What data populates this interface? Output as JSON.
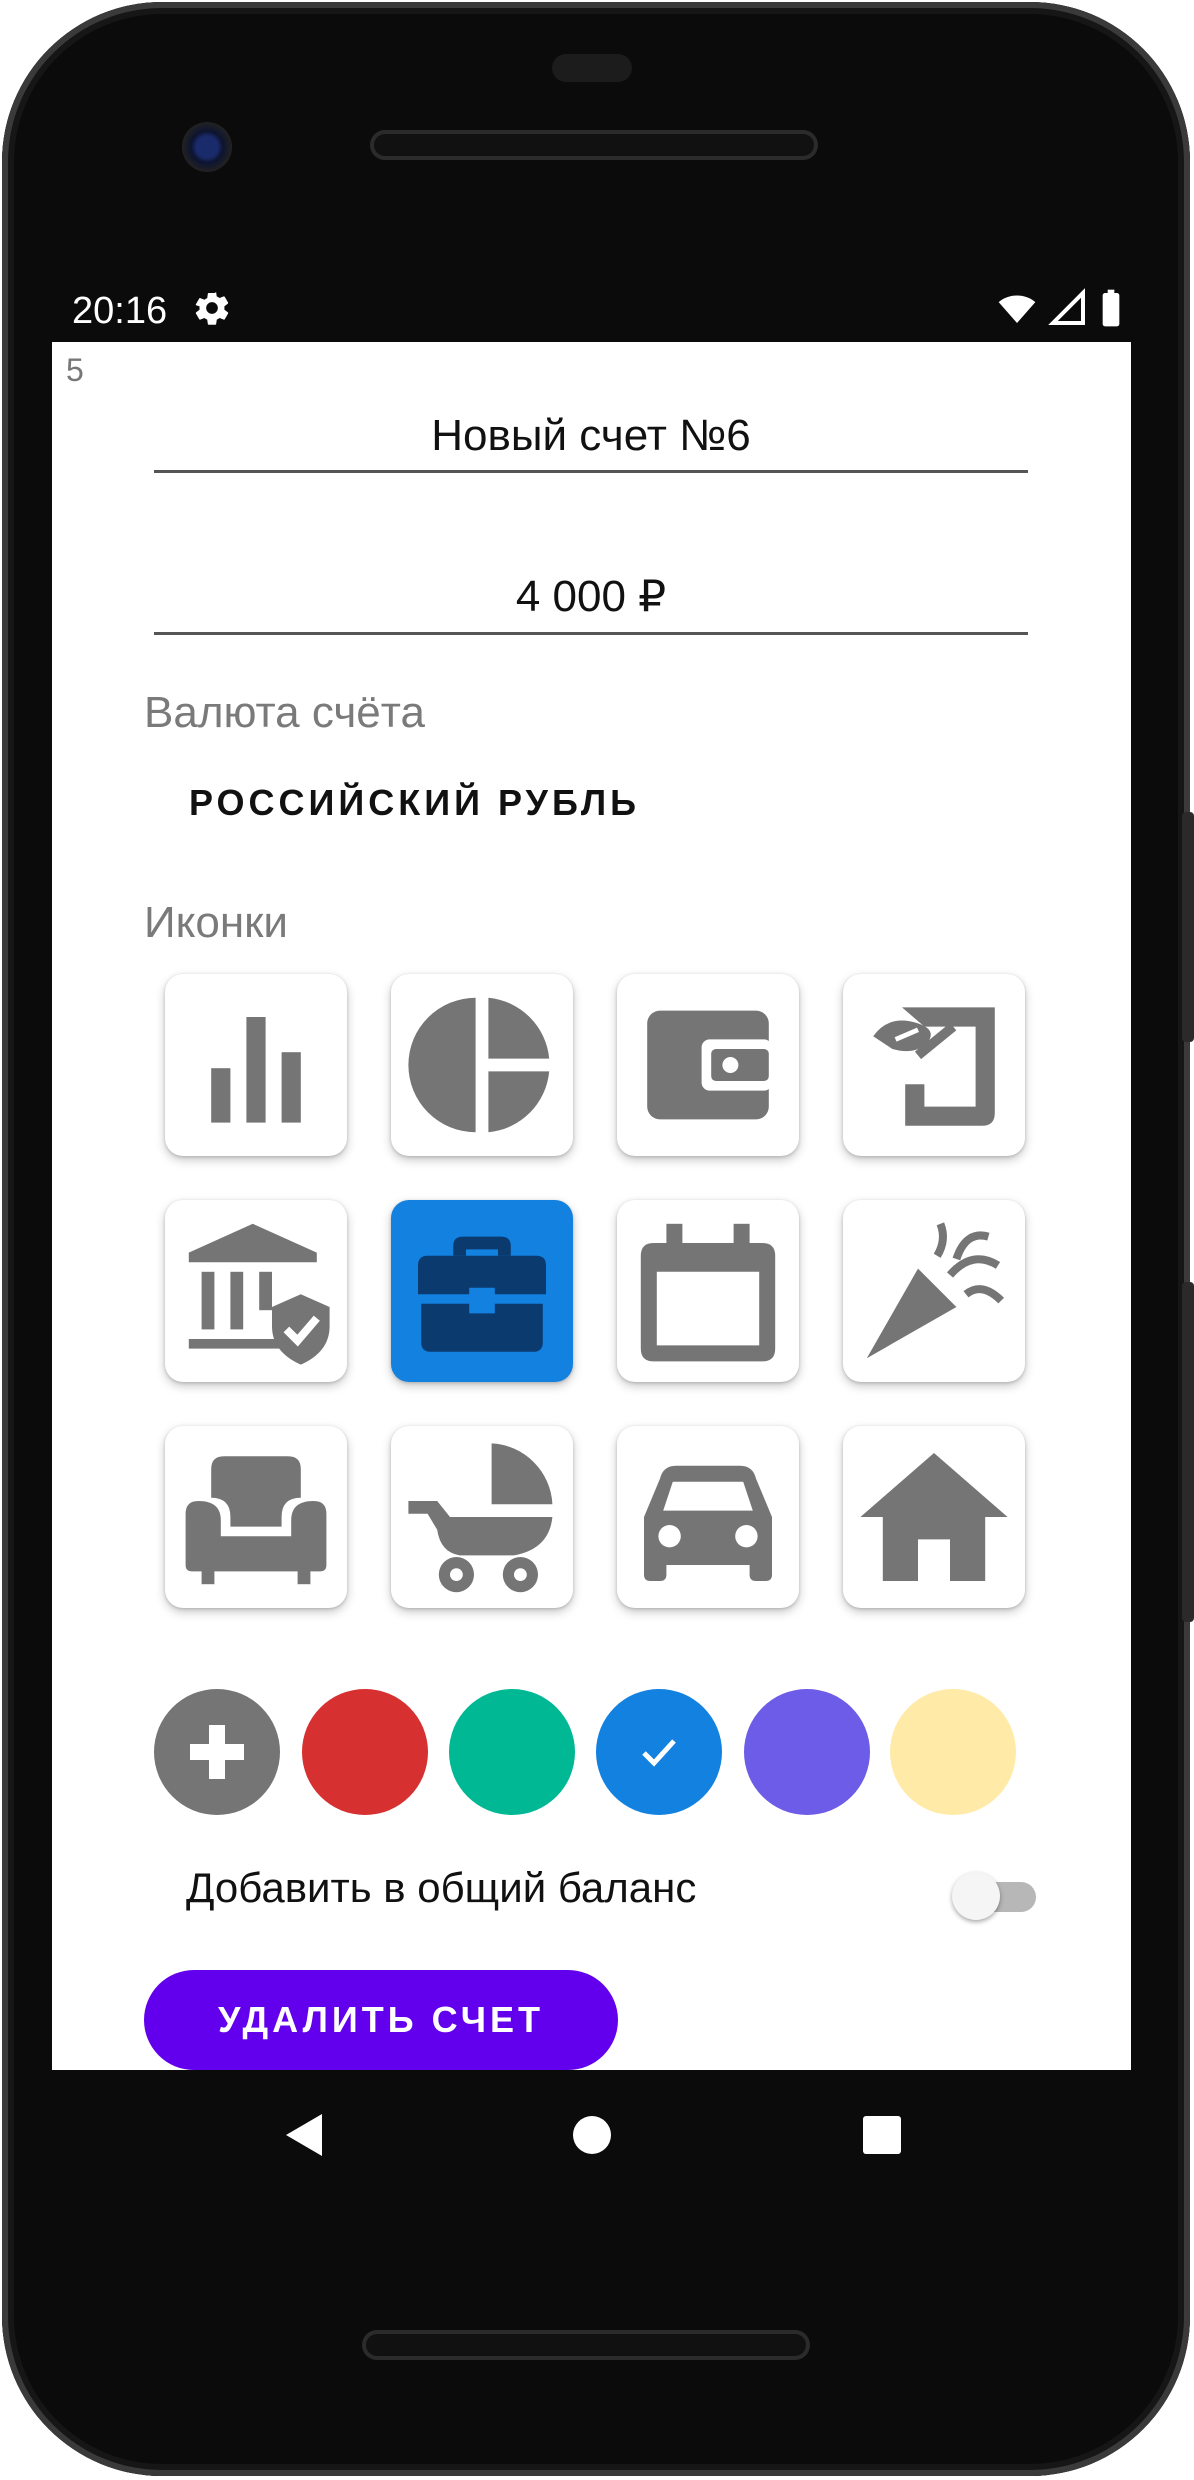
{
  "status_bar": {
    "time": "20:16",
    "settings_icon": "gear-icon",
    "wifi_icon": "wifi-icon",
    "signal_icon": "cell-signal-icon",
    "battery_icon": "battery-icon"
  },
  "screen": {
    "corner_number": "5",
    "account_name": "Новый счет №6",
    "balance": "4 000 ₽",
    "currency_label": "Валюта счёта",
    "currency_value": "РОССИЙСКИЙ РУБЛЬ",
    "icons_label": "Иконки",
    "icons": [
      {
        "name": "bar-chart-icon",
        "selected": false
      },
      {
        "name": "pie-chart-icon",
        "selected": false
      },
      {
        "name": "wallet-icon",
        "selected": false
      },
      {
        "name": "money-hand-icon",
        "selected": false
      },
      {
        "name": "bank-shield-icon",
        "selected": false
      },
      {
        "name": "briefcase-icon",
        "selected": true
      },
      {
        "name": "calendar-icon",
        "selected": false
      },
      {
        "name": "party-popper-icon",
        "selected": false
      },
      {
        "name": "armchair-icon",
        "selected": false
      },
      {
        "name": "baby-stroller-icon",
        "selected": false
      },
      {
        "name": "car-icon",
        "selected": false
      },
      {
        "name": "home-icon",
        "selected": false
      }
    ],
    "colors": [
      {
        "name": "add-color",
        "hex": "#757575",
        "selected": false
      },
      {
        "name": "red",
        "hex": "#d63031",
        "selected": false
      },
      {
        "name": "green",
        "hex": "#00b894",
        "selected": false
      },
      {
        "name": "blue",
        "hex": "#1281e0",
        "selected": true
      },
      {
        "name": "purple",
        "hex": "#6c5ce7",
        "selected": false
      },
      {
        "name": "yellow",
        "hex": "#ffeaa7",
        "selected": false
      }
    ],
    "toggle_label": "Добавить в общий баланс",
    "toggle_on": false,
    "delete_button": "УДАЛИТЬ СЧЕТ"
  },
  "nav_bar": {
    "back_icon": "back-triangle-icon",
    "home_icon": "home-circle-icon",
    "recents_icon": "recents-square-icon"
  }
}
